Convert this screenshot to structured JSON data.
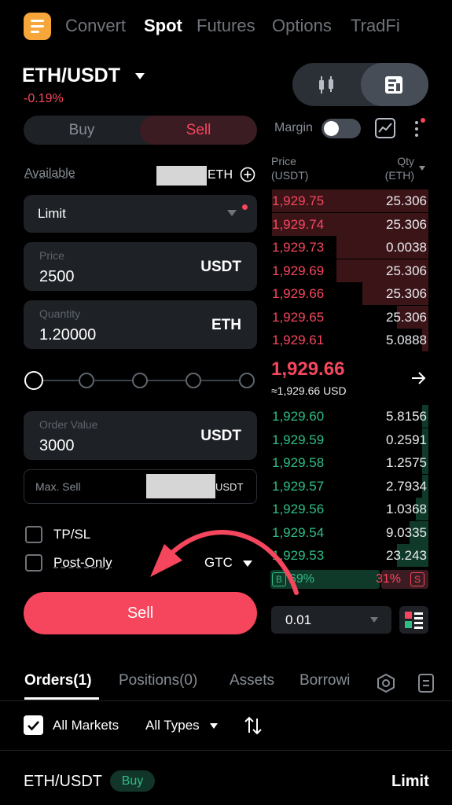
{
  "nav": {
    "tabs": [
      "Convert",
      "Spot",
      "Futures",
      "Options",
      "TradFi"
    ],
    "active": "Spot"
  },
  "market": {
    "pair": "ETH/USDT",
    "change": "-0.19%"
  },
  "trade": {
    "buy_label": "Buy",
    "sell_label": "Sell",
    "margin_label": "Margin",
    "available_label": "Available",
    "available_unit": "ETH",
    "order_type": "Limit",
    "price_label": "Price",
    "price_value": "2500",
    "price_unit": "USDT",
    "qty_label": "Quantity",
    "qty_value": "1.20000",
    "qty_unit": "ETH",
    "order_value_label": "Order Value",
    "order_value": "3000",
    "order_value_unit": "USDT",
    "max_sell_label": "Max. Sell",
    "max_sell_unit": "USDT",
    "tpsl_label": "TP/SL",
    "postonly_label": "Post-Only",
    "tif": "GTC",
    "submit_label": "Sell"
  },
  "orderbook": {
    "price_header": "Price",
    "price_unit": "(USDT)",
    "qty_header": "Qty",
    "qty_unit": "(ETH)",
    "asks": [
      {
        "price": "1,929.75",
        "qty": "25.306",
        "depth": 0.99
      },
      {
        "price": "1,929.74",
        "qty": "25.306",
        "depth": 0.99
      },
      {
        "price": "1,929.73",
        "qty": "0.0038",
        "depth": 0.58
      },
      {
        "price": "1,929.69",
        "qty": "25.306",
        "depth": 0.58
      },
      {
        "price": "1,929.66",
        "qty": "25.306",
        "depth": 0.42
      },
      {
        "price": "1,929.65",
        "qty": "25.306",
        "depth": 0.2
      },
      {
        "price": "1,929.61",
        "qty": "5.0888",
        "depth": 0.04
      }
    ],
    "last_price": "1,929.66",
    "last_price_usd": "≈1,929.66 USD",
    "bids": [
      {
        "price": "1,929.60",
        "qty": "5.8156",
        "depth": 0.04
      },
      {
        "price": "1,929.59",
        "qty": "0.2591",
        "depth": 0.04
      },
      {
        "price": "1,929.58",
        "qty": "1.2575",
        "depth": 0.04
      },
      {
        "price": "1,929.57",
        "qty": "2.7934",
        "depth": 0.04
      },
      {
        "price": "1,929.56",
        "qty": "1.0368",
        "depth": 0.08
      },
      {
        "price": "1,929.54",
        "qty": "9.0335",
        "depth": 0.12
      },
      {
        "price": "1,929.53",
        "qty": "23.243",
        "depth": 0.2
      }
    ],
    "buy_badge": "B",
    "buy_pct": "69%",
    "sell_pct": "31%",
    "sell_badge": "S",
    "tick_size": "0.01"
  },
  "bottom": {
    "tabs": [
      "Orders(1)",
      "Positions(0)",
      "Assets",
      "Borrowi"
    ],
    "filter_markets": "All Markets",
    "filter_types": "All Types",
    "order_pair": "ETH/USDT",
    "order_side": "Buy",
    "order_type": "Limit"
  },
  "colors": {
    "sell": "#f6465d",
    "buy": "#2ebd85",
    "accent": "#f7a63a"
  }
}
